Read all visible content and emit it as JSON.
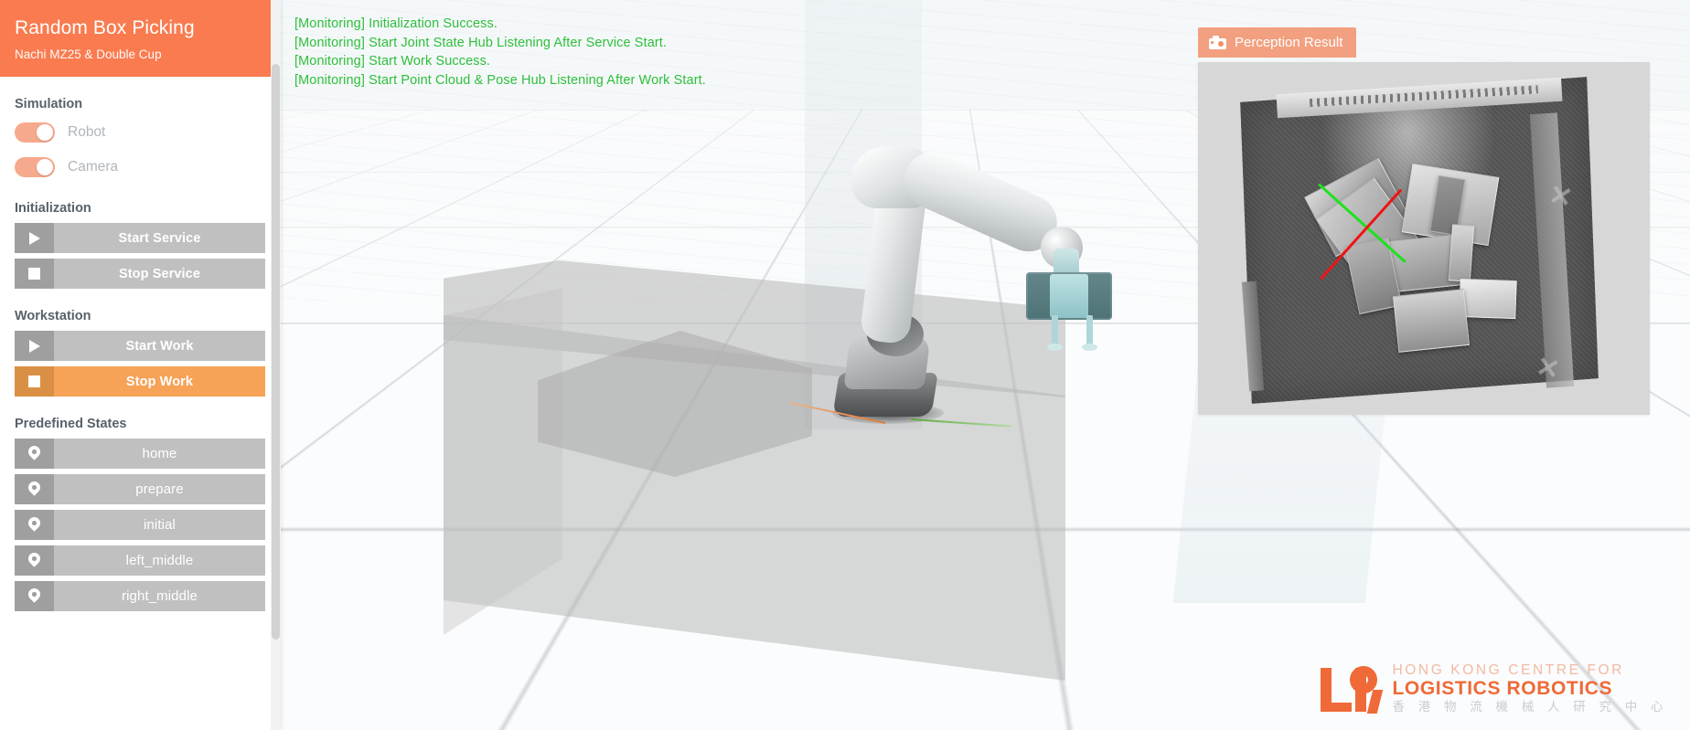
{
  "app": {
    "title": "Random Box Picking",
    "subtitle": "Nachi MZ25 & Double Cup",
    "accent_color": "#f97b4f",
    "log_color": "#2ebf3c"
  },
  "sidebar": {
    "sections": [
      {
        "label": "Simulation"
      },
      {
        "label": "Initialization"
      },
      {
        "label": "Workstation"
      },
      {
        "label": "Predefined States"
      }
    ],
    "toggles": [
      {
        "label": "Robot",
        "icon": "toggle-on-icon",
        "state": "on"
      },
      {
        "label": "Camera",
        "icon": "toggle-on-icon",
        "state": "on"
      }
    ],
    "initialization": [
      {
        "label": "Start Service",
        "icon": "play-icon",
        "active": false
      },
      {
        "label": "Stop Service",
        "icon": "stop-icon",
        "active": false
      }
    ],
    "workstation": [
      {
        "label": "Start Work",
        "icon": "play-icon",
        "active": false
      },
      {
        "label": "Stop Work",
        "icon": "stop-icon",
        "active": true
      }
    ],
    "predefined_states": [
      {
        "label": "home",
        "icon": "map-pin-icon"
      },
      {
        "label": "prepare",
        "icon": "map-pin-icon"
      },
      {
        "label": "initial",
        "icon": "map-pin-icon"
      },
      {
        "label": "left_middle",
        "icon": "map-pin-icon"
      },
      {
        "label": "right_middle",
        "icon": "map-pin-icon"
      }
    ]
  },
  "log": {
    "lines": [
      "[Monitoring] Initialization Success.",
      "[Monitoring] Start Joint State Hub Listening After Service Start.",
      "[Monitoring] Start Work Success.",
      "[Monitoring] Start Point Cloud & Pose Hub Listening After Work Start."
    ]
  },
  "perception": {
    "tab_label": "Perception Result",
    "tab_icon": "camera-icon"
  },
  "logo": {
    "line1": "HONG KONG CENTRE FOR",
    "line2": "LOGISTICS ROBOTICS",
    "line3": "香 港 物 流 機 械 人 研 究 中 心"
  }
}
